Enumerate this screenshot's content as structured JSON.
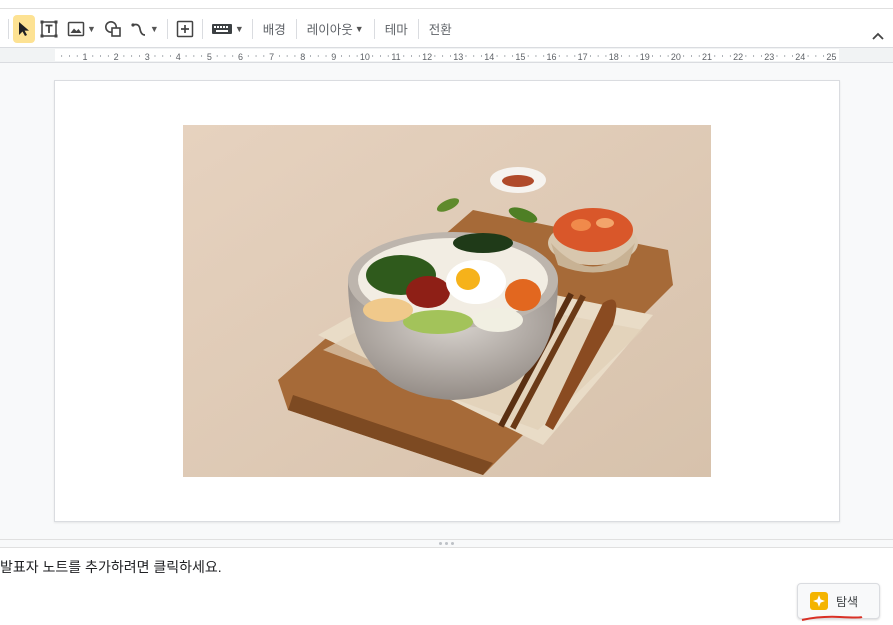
{
  "toolbar": {
    "tools": [
      {
        "name": "select-tool",
        "icon": "cursor-icon"
      },
      {
        "name": "textbox-tool",
        "icon": "textbox-icon"
      },
      {
        "name": "image-tool",
        "icon": "image-icon"
      },
      {
        "name": "shape-tool",
        "icon": "shape-icon"
      },
      {
        "name": "line-tool",
        "icon": "line-icon"
      },
      {
        "name": "comment-tool",
        "icon": "add-comment-icon"
      },
      {
        "name": "input-tools",
        "icon": "keyboard-icon"
      }
    ],
    "background_label": "배경",
    "layout_label": "레이아웃",
    "theme_label": "테마",
    "transition_label": "전환",
    "active_color": "#fde293"
  },
  "ruler": {
    "numbers": [
      "1",
      "2",
      "3",
      "4",
      "5",
      "6",
      "7",
      "8",
      "9",
      "10",
      "11",
      "12",
      "13",
      "14",
      "15",
      "16",
      "17",
      "18",
      "19",
      "20",
      "21",
      "22",
      "23",
      "24",
      "25"
    ]
  },
  "slide": {
    "image_description_icon": "bibimbap-photo"
  },
  "notes": {
    "placeholder": "발표자 노트를 추가하려면 클릭하세요."
  },
  "explore": {
    "label": "탐색",
    "icon": "explore-icon",
    "icon_color": "#f4b400"
  },
  "accent_colors": {
    "underline": "#d93025"
  }
}
